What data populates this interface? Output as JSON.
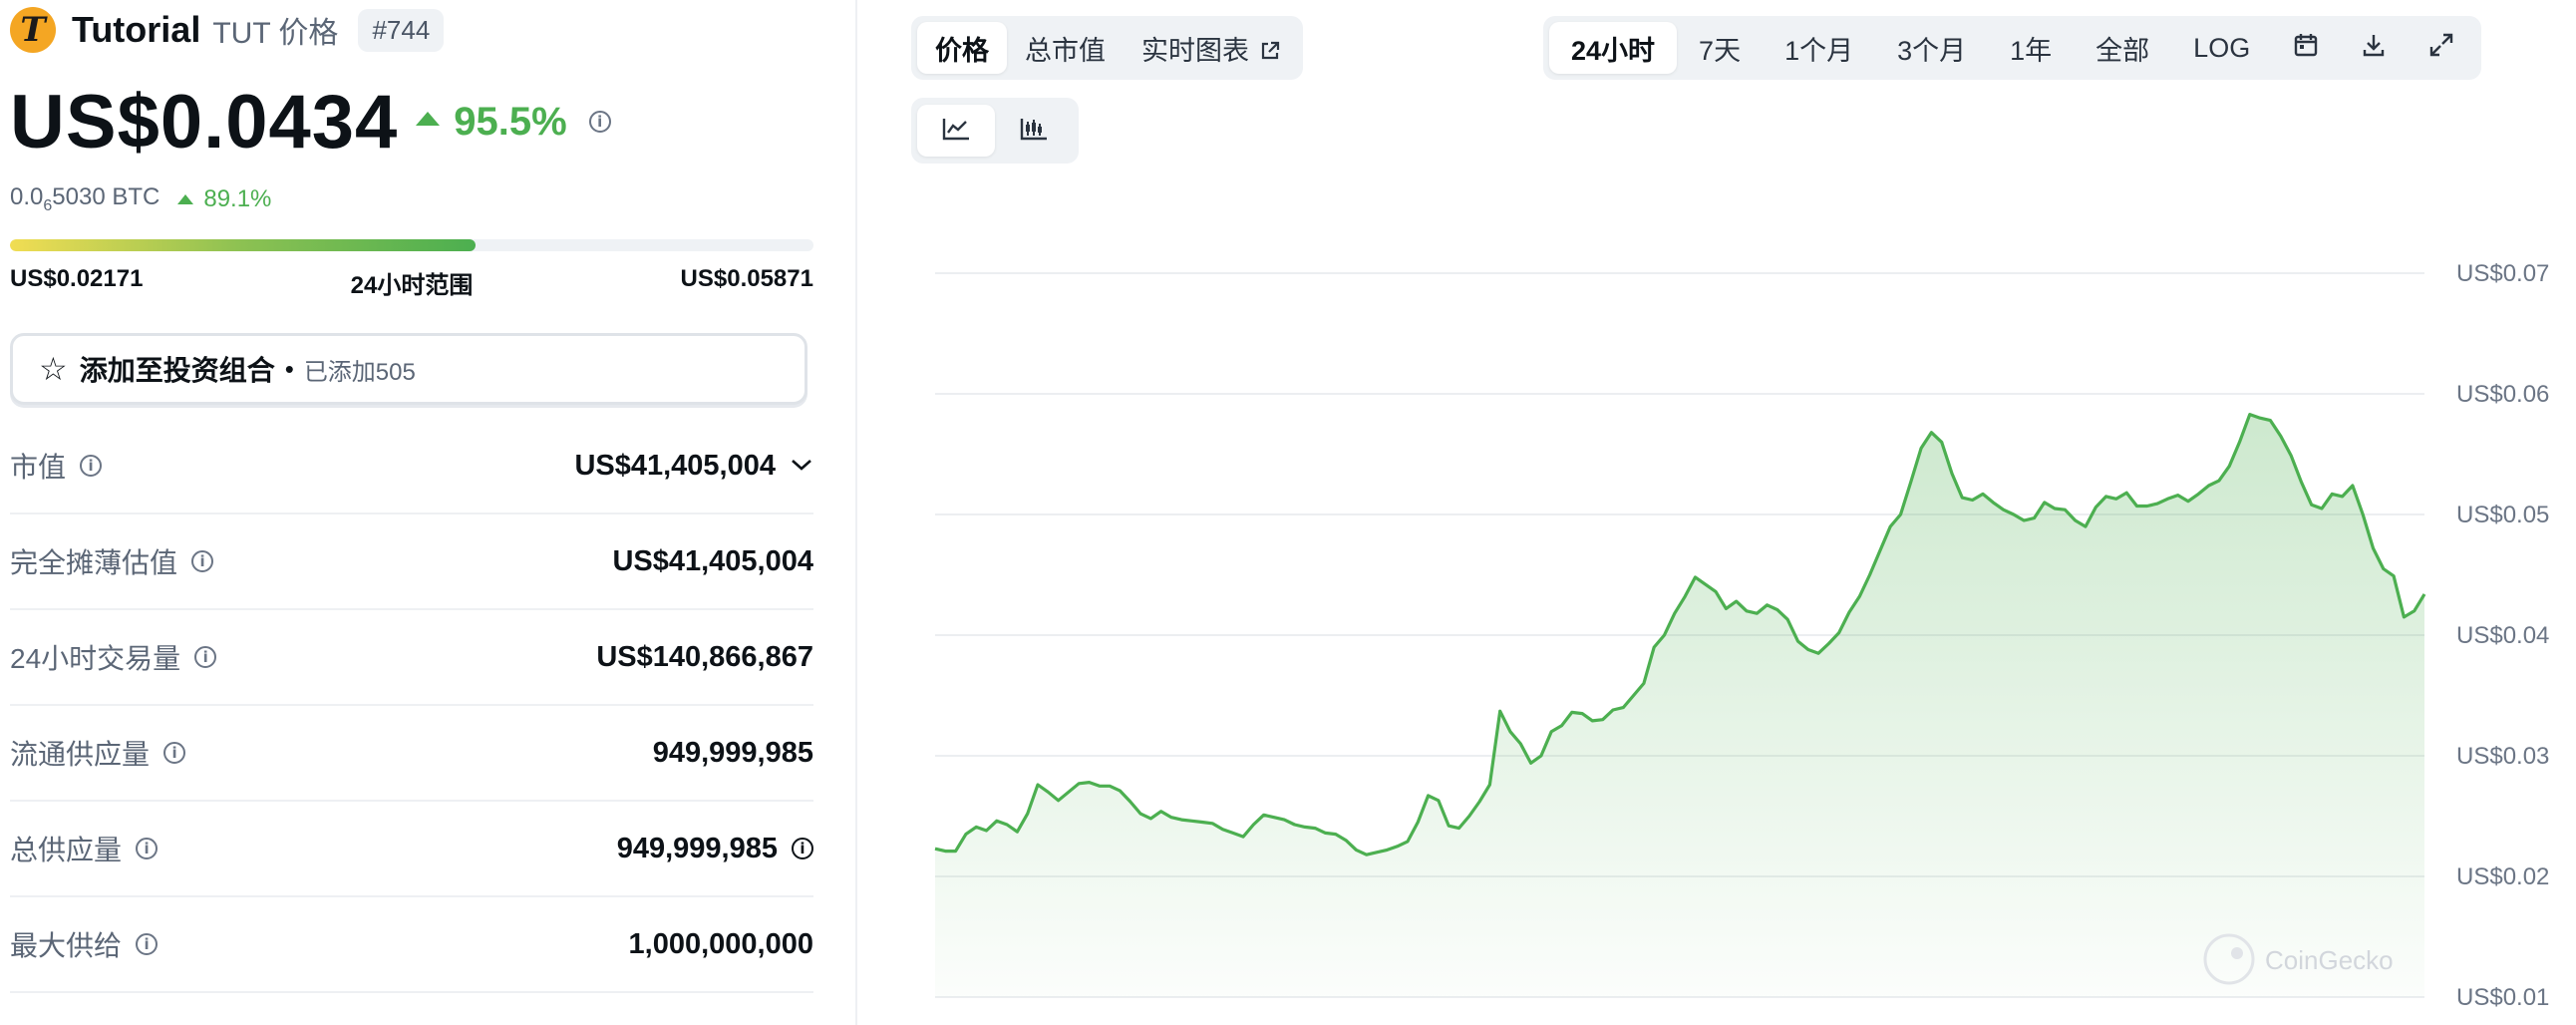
{
  "coin": {
    "logo_letter": "T",
    "name": "Tutorial",
    "symbol_label": "TUT 价格",
    "rank": "#744"
  },
  "price": {
    "value": "US$0.0434",
    "change_24h": "95.5%",
    "btc_prefix": "0.0",
    "btc_sub": "6",
    "btc_rest": "5030 BTC",
    "btc_change": "89.1%"
  },
  "range": {
    "low": "US$0.02171",
    "label": "24小时范围",
    "high": "US$0.05871",
    "position_fraction": 0.58
  },
  "portfolio": {
    "label": "添加至投资组合",
    "added": "已添加505"
  },
  "stats": [
    {
      "label": "市值",
      "value": "US$41,405,004"
    },
    {
      "label": "完全摊薄估值",
      "value": "US$41,405,004"
    },
    {
      "label": "24小时交易量",
      "value": "US$140,866,867"
    },
    {
      "label": "流通供应量",
      "value": "949,999,985"
    },
    {
      "label": "总供应量",
      "value": "949,999,985"
    },
    {
      "label": "最大供给",
      "value": "1,000,000,000"
    }
  ],
  "toolbar": {
    "left_tabs": [
      "价格",
      "总市值",
      "实时图表"
    ],
    "range_tabs": [
      "24小时",
      "7天",
      "1个月",
      "3个月",
      "1年",
      "全部",
      "LOG"
    ],
    "active_range": "24小时",
    "active_left": "价格"
  },
  "icons": {
    "logo": "tutorial-logo-icon",
    "info": "info-icon",
    "star": "star-icon",
    "chevron": "chevron-down-icon",
    "external": "external-link-icon",
    "line_chart": "line-chart-icon",
    "candle_chart": "candlestick-chart-icon",
    "calendar": "calendar-icon",
    "download": "download-icon",
    "expand": "expand-icon"
  },
  "colors": {
    "positive": "#4caf50",
    "line": "#4caf50",
    "logo": "#f4a623"
  },
  "watermark": "CoinGecko",
  "chart_data": {
    "type": "area",
    "title": "",
    "xlabel": "",
    "ylabel": "",
    "y_ticks": [
      "US$0.07",
      "US$0.06",
      "US$0.05",
      "US$0.04",
      "US$0.03",
      "US$0.02",
      "US$0.01"
    ],
    "ylim": [
      0.01,
      0.07
    ],
    "grid": true,
    "series": [
      {
        "values": [
          0.0223,
          0.0221,
          0.0221,
          0.0235,
          0.0241,
          0.0238,
          0.0246,
          0.0243,
          0.0237,
          0.0252,
          0.0276,
          0.027,
          0.0263,
          0.027,
          0.0277,
          0.0278,
          0.0275,
          0.0275,
          0.0271,
          0.0262,
          0.0252,
          0.0248,
          0.0254,
          0.0249,
          0.0247,
          0.0246,
          0.0245,
          0.0244,
          0.0239,
          0.0236,
          0.0233,
          0.0243,
          0.0251,
          0.0249,
          0.0247,
          0.0243,
          0.0241,
          0.024,
          0.0236,
          0.0235,
          0.023,
          0.0222,
          0.0218,
          0.022,
          0.0222,
          0.0225,
          0.0229,
          0.0245,
          0.0267,
          0.0263,
          0.0242,
          0.024,
          0.025,
          0.0262,
          0.0276,
          0.0337,
          0.032,
          0.031,
          0.0294,
          0.03,
          0.032,
          0.0325,
          0.0336,
          0.0335,
          0.0329,
          0.033,
          0.0338,
          0.034,
          0.035,
          0.036,
          0.039,
          0.04,
          0.0418,
          0.0432,
          0.0448,
          0.0442,
          0.0436,
          0.0422,
          0.0428,
          0.042,
          0.0418,
          0.0425,
          0.0421,
          0.0413,
          0.0395,
          0.0388,
          0.0385,
          0.0393,
          0.0402,
          0.0419,
          0.0432,
          0.045,
          0.047,
          0.049,
          0.05,
          0.0527,
          0.0555,
          0.0568,
          0.056,
          0.0534,
          0.0514,
          0.0512,
          0.0517,
          0.051,
          0.0504,
          0.05,
          0.0495,
          0.0497,
          0.051,
          0.0505,
          0.0504,
          0.0495,
          0.049,
          0.0506,
          0.0515,
          0.0513,
          0.0518,
          0.0507,
          0.0507,
          0.0509,
          0.0513,
          0.0516,
          0.0511,
          0.0517,
          0.0524,
          0.0528,
          0.054,
          0.056,
          0.0583,
          0.058,
          0.0578,
          0.0565,
          0.0549,
          0.0527,
          0.0508,
          0.0505,
          0.0517,
          0.0515,
          0.0524,
          0.05,
          0.0472,
          0.0455,
          0.0449,
          0.0415,
          0.042,
          0.0434
        ]
      }
    ]
  }
}
